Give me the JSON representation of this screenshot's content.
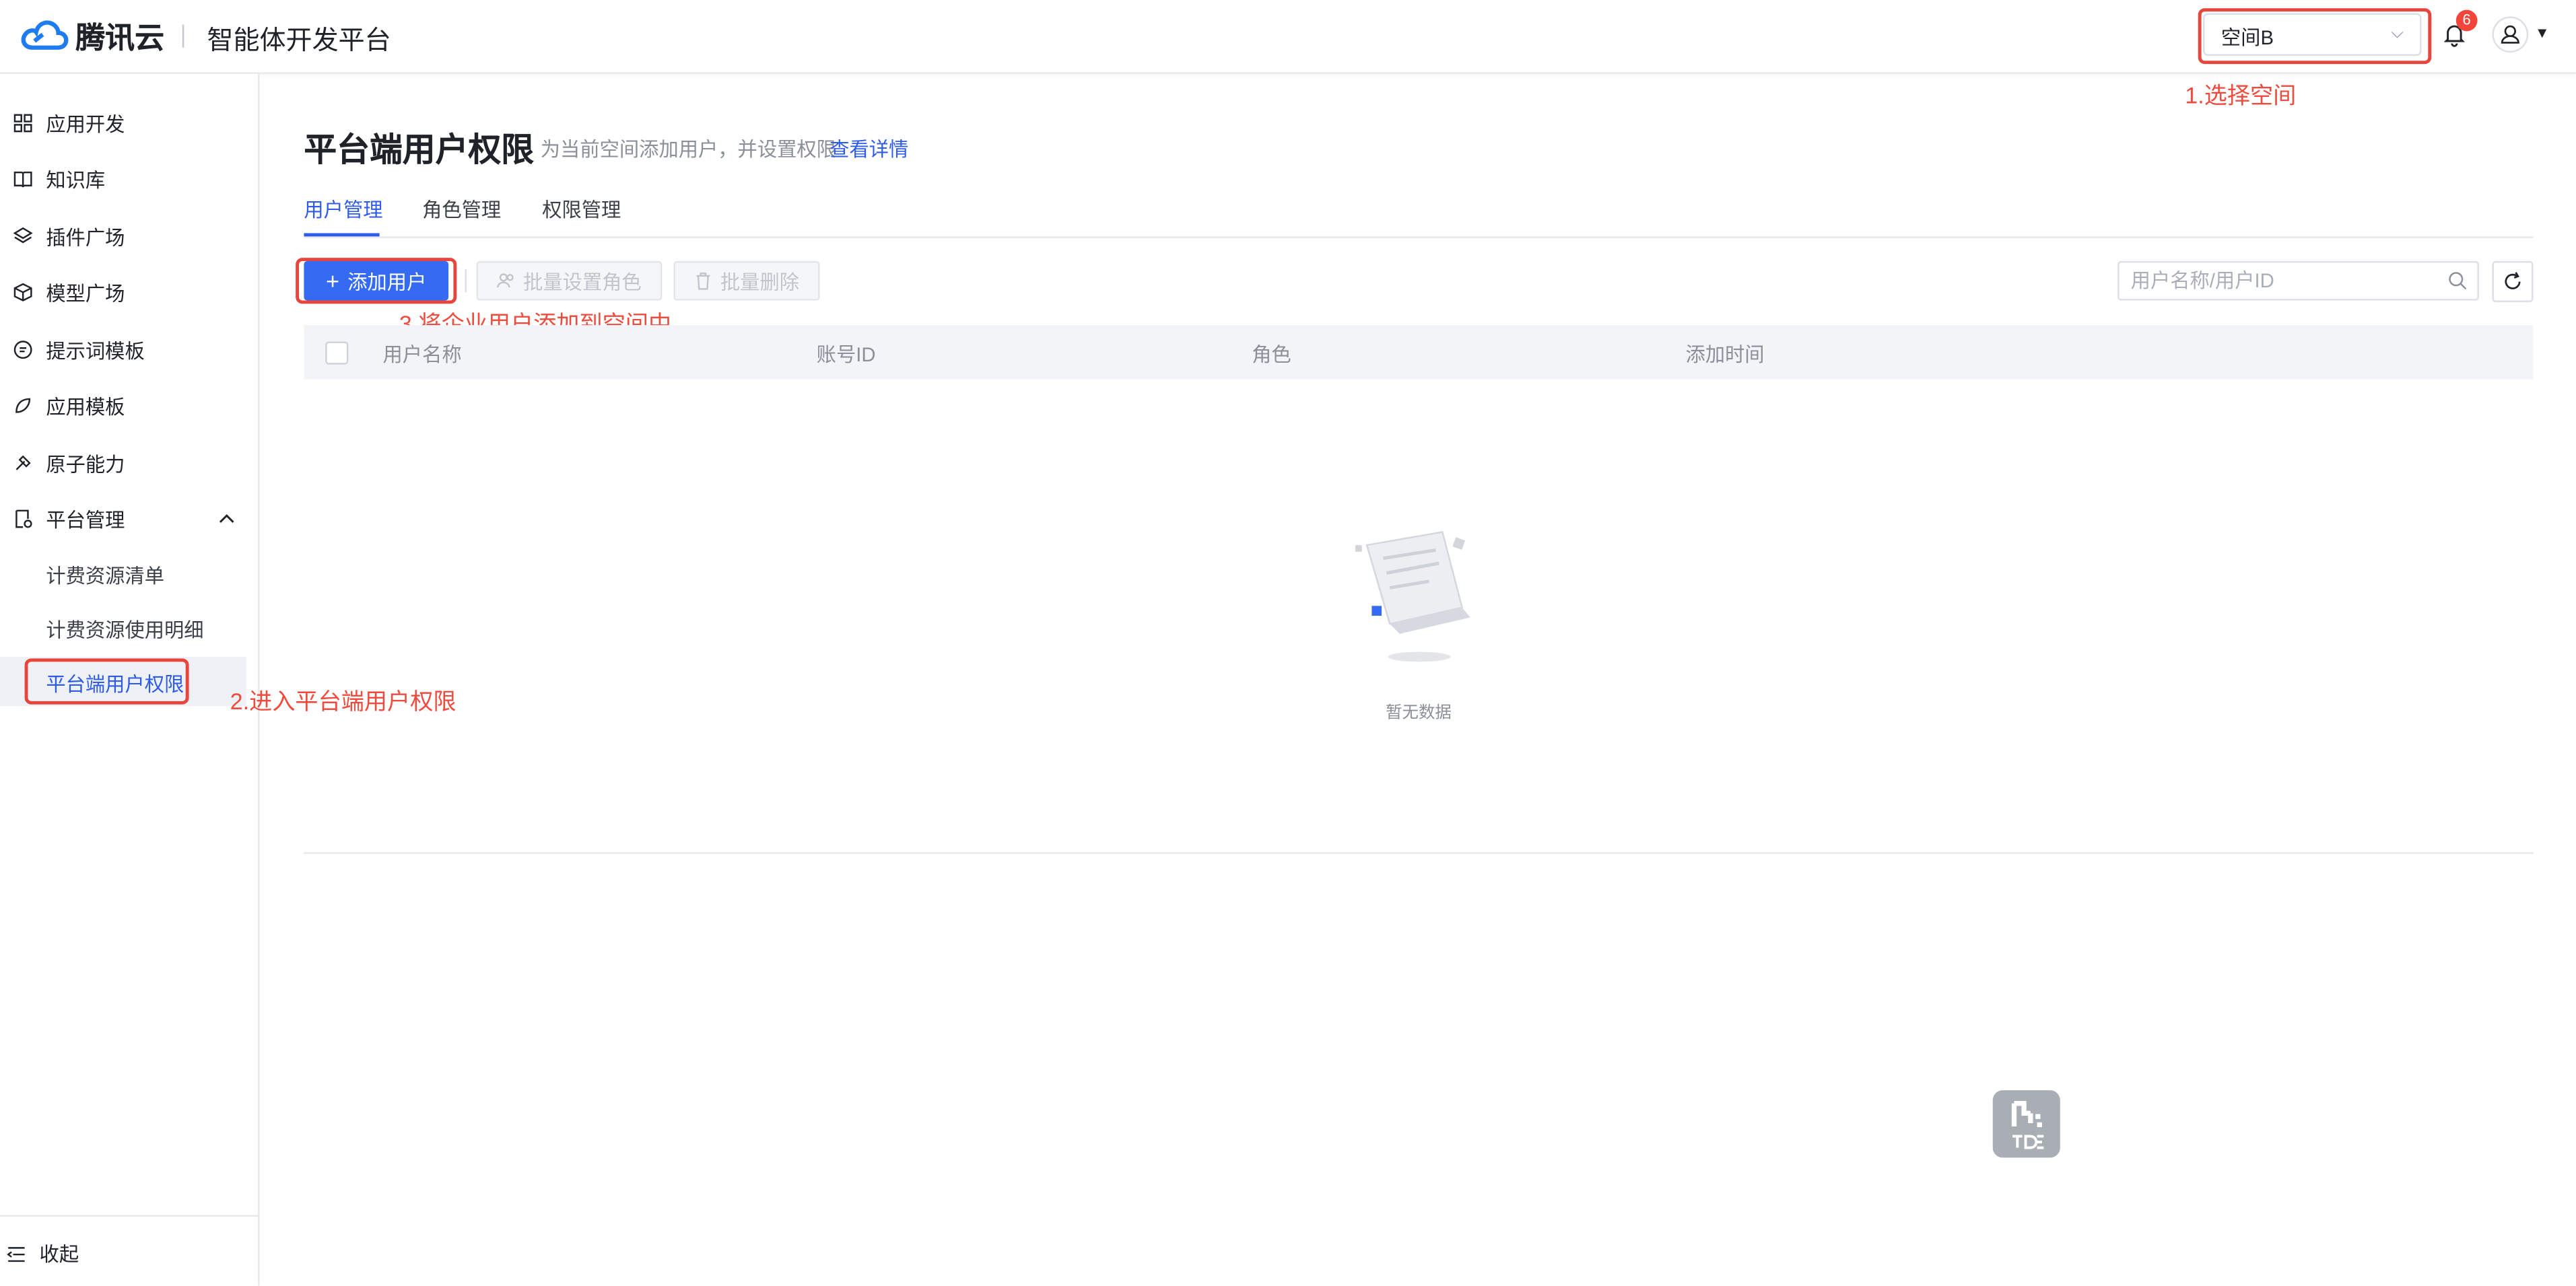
{
  "header": {
    "brand": "腾讯云",
    "platform": "智能体开发平台",
    "space_selected": "空间B",
    "notification_count": "6"
  },
  "sidebar": {
    "items": [
      {
        "label": "应用开发",
        "icon": "grid-icon"
      },
      {
        "label": "知识库",
        "icon": "book-icon"
      },
      {
        "label": "插件广场",
        "icon": "layers-icon"
      },
      {
        "label": "模型广场",
        "icon": "cube-icon"
      },
      {
        "label": "提示词模板",
        "icon": "chat-icon"
      },
      {
        "label": "应用模板",
        "icon": "template-icon"
      },
      {
        "label": "原子能力",
        "icon": "tool-icon"
      },
      {
        "label": "平台管理",
        "icon": "settings-doc-icon"
      }
    ],
    "sub_items": [
      "计费资源清单",
      "计费资源使用明细",
      "平台端用户权限"
    ],
    "collapse_label": "收起"
  },
  "page": {
    "title": "平台端用户权限",
    "subtitle": "为当前空间添加用户，并设置权限",
    "detail_link": "查看详情",
    "tabs": [
      "用户管理",
      "角色管理",
      "权限管理"
    ]
  },
  "toolbar": {
    "add_user": "添加用户",
    "batch_role": "批量设置角色",
    "batch_delete": "批量删除",
    "search_placeholder": "用户名称/用户ID"
  },
  "table": {
    "columns": [
      "用户名称",
      "账号ID",
      "角色",
      "添加时间"
    ],
    "rows": [],
    "empty_text": "暂无数据"
  },
  "annotations": {
    "step1": "1.选择空间",
    "step2": "2.进入平台端用户权限",
    "step3": "3.将企业用户添加到空间中"
  },
  "colors": {
    "primary": "#356bf3",
    "link": "#2f5bea",
    "annotation": "#ef4b3f"
  }
}
